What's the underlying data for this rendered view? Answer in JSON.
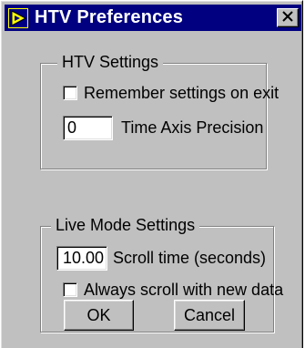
{
  "window": {
    "title": "HTV Preferences",
    "app_icon": "labview-run-arrow-icon",
    "close_glyph": "close-icon"
  },
  "htv_settings": {
    "group_label": "HTV Settings",
    "remember_checkbox": {
      "label": "Remember settings on exit",
      "checked": false
    },
    "precision": {
      "value": "0",
      "label": "Time Axis Precision"
    }
  },
  "live_mode_settings": {
    "group_label": "Live Mode Settings",
    "scroll_time": {
      "value": "10.00",
      "label": "Scroll time (seconds)"
    },
    "always_scroll_checkbox": {
      "label": "Always scroll with new data",
      "checked": false
    }
  },
  "buttons": {
    "ok_label": "OK",
    "cancel_label": "Cancel"
  },
  "colors": {
    "titlebar": "#000080",
    "face": "#c0c0c0",
    "icon_yellow": "#ffff00"
  }
}
